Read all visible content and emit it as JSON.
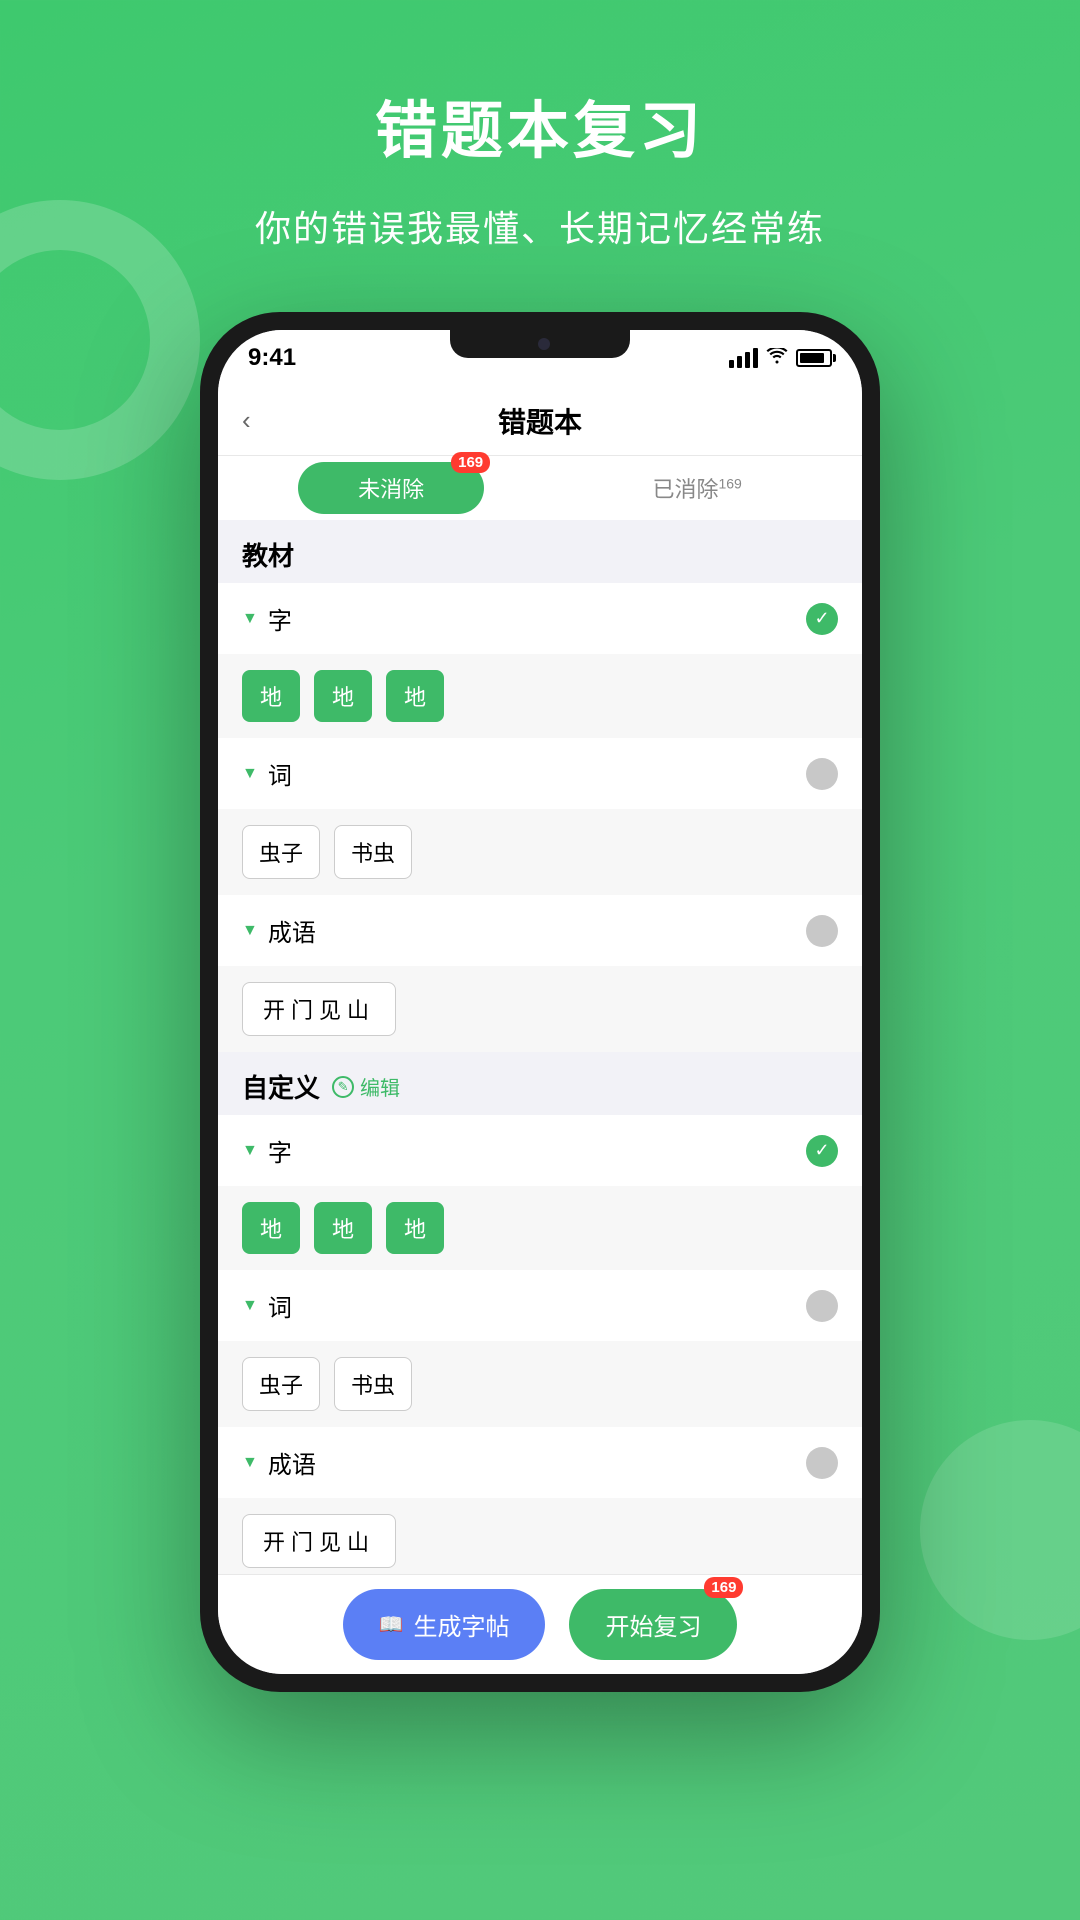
{
  "page": {
    "title": "错题本复习",
    "subtitle": "你的错误我最懂、长期记忆经常练"
  },
  "status_bar": {
    "time": "9:41"
  },
  "app": {
    "screen_title": "错题本",
    "back_label": "‹"
  },
  "tabs": {
    "active": "未消除",
    "active_badge": "169",
    "inactive": "已消除",
    "inactive_badge": "169"
  },
  "sections": [
    {
      "id": "textbook",
      "title": "教材",
      "categories": [
        {
          "id": "zi1",
          "label": "字",
          "checked": true,
          "items": [
            "地",
            "地",
            "地"
          ],
          "item_type": "green"
        },
        {
          "id": "ci1",
          "label": "词",
          "checked": false,
          "items": [
            "虫子",
            "书虫"
          ],
          "item_type": "outline"
        },
        {
          "id": "chengyu1",
          "label": "成语",
          "checked": false,
          "items": [
            "开门见山"
          ],
          "item_type": "outline_wide"
        }
      ]
    },
    {
      "id": "custom",
      "title": "自定义",
      "edit_label": "编辑",
      "categories": [
        {
          "id": "zi2",
          "label": "字",
          "checked": true,
          "items": [
            "地",
            "地",
            "地"
          ],
          "item_type": "green"
        },
        {
          "id": "ci2",
          "label": "词",
          "checked": false,
          "items": [
            "虫子",
            "书虫"
          ],
          "item_type": "outline"
        },
        {
          "id": "chengyu2",
          "label": "成语",
          "checked": false,
          "items": [
            "开门见山"
          ],
          "item_type": "outline_wide"
        }
      ]
    }
  ],
  "bottom": {
    "generate_label": "生成字帖",
    "start_label": "开始复习",
    "start_badge": "169"
  }
}
